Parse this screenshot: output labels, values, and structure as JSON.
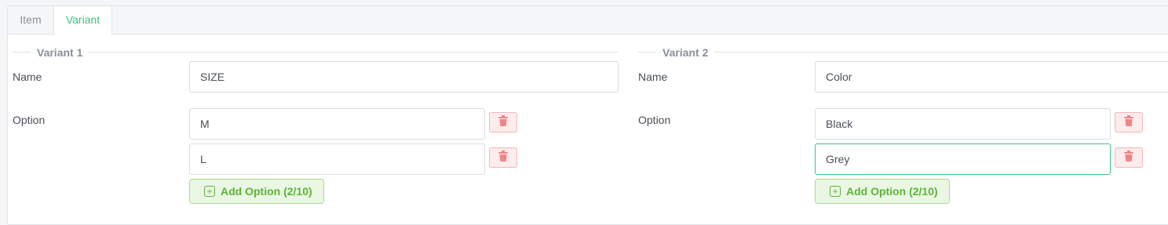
{
  "tabs": [
    {
      "label": "Item",
      "active": false
    },
    {
      "label": "Variant",
      "active": true
    }
  ],
  "variants": [
    {
      "title": "Variant 1",
      "name_label": "Name",
      "name_value": "SIZE",
      "option_label": "Option",
      "options": [
        "M",
        "L"
      ],
      "add_option_label": "Add Option (2/10)"
    },
    {
      "title": "Variant 2",
      "name_label": "Name",
      "name_value": "Color",
      "option_label": "Option",
      "options": [
        "Black",
        "Grey"
      ],
      "add_option_label": "Add Option (2/10)"
    }
  ],
  "colors": {
    "accent": "#3cc57f",
    "danger": "#f08585",
    "success_text": "#5bb539"
  }
}
